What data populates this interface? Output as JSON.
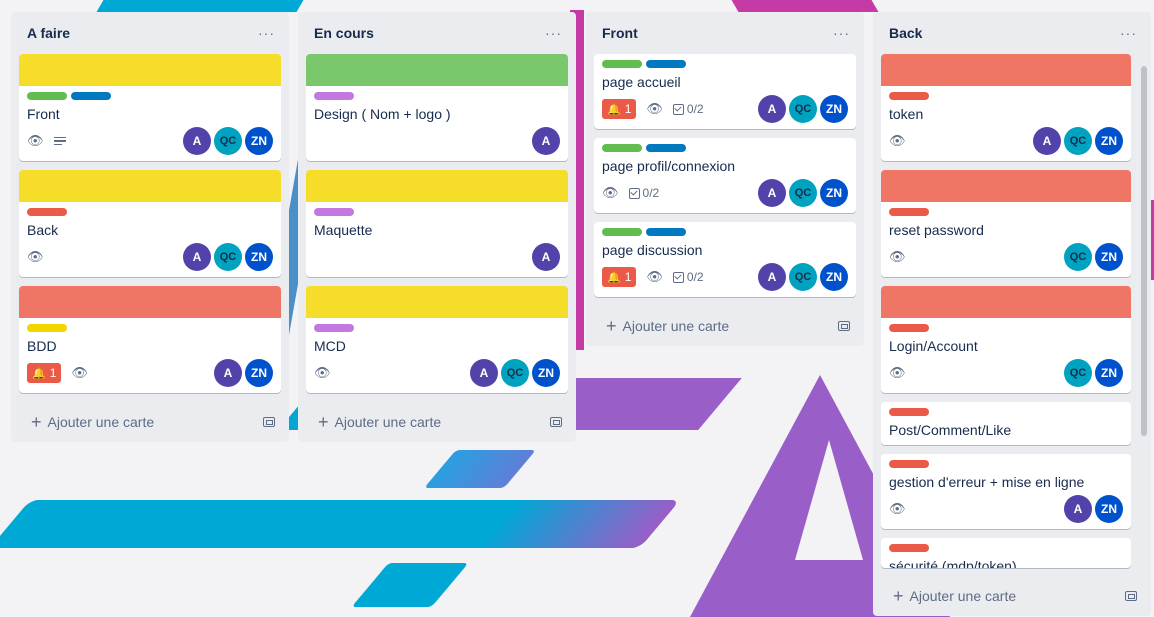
{
  "colors": {
    "yellow": "#f5dd29",
    "green": "#7bc86c",
    "red": "#ef7564",
    "label_green": "#61bd4f",
    "label_blue": "#0079bf",
    "label_red": "#eb5a46",
    "label_purple": "#c377e0",
    "label_yellow": "#f2d600"
  },
  "lists": [
    {
      "title": "A faire",
      "menu": "···",
      "add_label": "Ajouter une carte",
      "cards": [
        {
          "title": "Front",
          "cover": "yellow",
          "labels": [
            "label_green",
            "label_blue"
          ],
          "badges": [
            "eye-icon",
            "description-icon"
          ],
          "members": [
            "A",
            "QC",
            "ZN"
          ]
        },
        {
          "title": "Back",
          "cover": "yellow",
          "labels": [
            "label_red"
          ],
          "badges": [
            "eye-icon"
          ],
          "members": [
            "A",
            "QC",
            "ZN"
          ]
        },
        {
          "title": "BDD",
          "cover": "red",
          "labels": [
            "label_yellow"
          ],
          "notifications": "1",
          "badges": [
            "eye-icon"
          ],
          "members": [
            "A",
            "ZN"
          ]
        }
      ]
    },
    {
      "title": "En cours",
      "menu": "···",
      "add_label": "Ajouter une carte",
      "cards": [
        {
          "title": "Design ( Nom + logo )",
          "cover": "green",
          "labels": [
            "label_purple"
          ],
          "badges": [],
          "members": [
            "A"
          ]
        },
        {
          "title": "Maquette",
          "cover": "yellow",
          "labels": [
            "label_purple"
          ],
          "badges": [],
          "members": [
            "A"
          ]
        },
        {
          "title": "MCD",
          "cover": "yellow",
          "labels": [
            "label_purple"
          ],
          "badges": [
            "eye-icon"
          ],
          "members": [
            "A",
            "QC",
            "ZN"
          ]
        }
      ]
    },
    {
      "title": "Front",
      "menu": "···",
      "add_label": "Ajouter une carte",
      "cards": [
        {
          "title": "page accueil",
          "labels": [
            "label_green",
            "label_blue"
          ],
          "notifications": "1",
          "checklist": "0/2",
          "members": [
            "A",
            "QC",
            "ZN"
          ]
        },
        {
          "title": "page profil/connexion",
          "labels": [
            "label_green",
            "label_blue"
          ],
          "checklist": "0/2",
          "members": [
            "A",
            "QC",
            "ZN"
          ]
        },
        {
          "title": "page discussion",
          "labels": [
            "label_green",
            "label_blue"
          ],
          "notifications": "1",
          "checklist": "0/2",
          "members": [
            "A",
            "QC",
            "ZN"
          ]
        }
      ]
    },
    {
      "title": "Back",
      "menu": "···",
      "add_label": "Ajouter une carte",
      "cards": [
        {
          "title": "token",
          "cover": "red",
          "labels": [
            "label_red"
          ],
          "badges": [
            "eye-icon"
          ],
          "members": [
            "A",
            "QC",
            "ZN"
          ]
        },
        {
          "title": "reset password",
          "cover": "red",
          "labels": [
            "label_red"
          ],
          "badges": [
            "eye-icon"
          ],
          "members": [
            "QC",
            "ZN"
          ]
        },
        {
          "title": "Login/Account",
          "cover": "red",
          "labels": [
            "label_red"
          ],
          "badges": [
            "eye-icon"
          ],
          "members": [
            "QC",
            "ZN"
          ]
        },
        {
          "title": "Post/Comment/Like",
          "labels": [
            "label_red"
          ],
          "badges": [],
          "members": []
        },
        {
          "title": "gestion d'erreur + mise en ligne",
          "labels": [
            "label_red"
          ],
          "badges": [
            "eye-icon"
          ],
          "members": [
            "A",
            "ZN"
          ]
        },
        {
          "title": "sécurité (mdp/token)",
          "labels": [
            "label_red"
          ],
          "badges": [],
          "members": []
        }
      ]
    }
  ]
}
